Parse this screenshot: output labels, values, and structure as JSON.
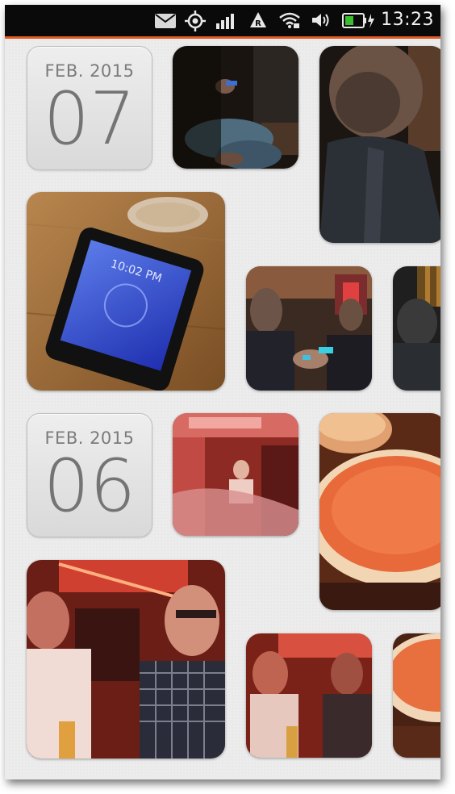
{
  "status_bar": {
    "time": "13:23",
    "icons": [
      "mail-icon",
      "location-icon",
      "signal-icon",
      "roaming-icon",
      "wifi-icon",
      "volume-icon",
      "battery-icon"
    ]
  },
  "accent_color": "#e05a22",
  "groups": [
    {
      "month": "FEB. 2015",
      "day": "07",
      "photos": [
        "photo-hands-with-phone",
        "photo-man-profile",
        "photo-phone-on-table",
        "photo-friends-with-phones",
        "photo-dark-interior"
      ]
    },
    {
      "month": "FEB. 2015",
      "day": "06",
      "photos": [
        "photo-red-restaurant",
        "photo-pizza-plate",
        "photo-people-red-light",
        "photo-blurry-people",
        "photo-pizza-closeup"
      ]
    }
  ]
}
